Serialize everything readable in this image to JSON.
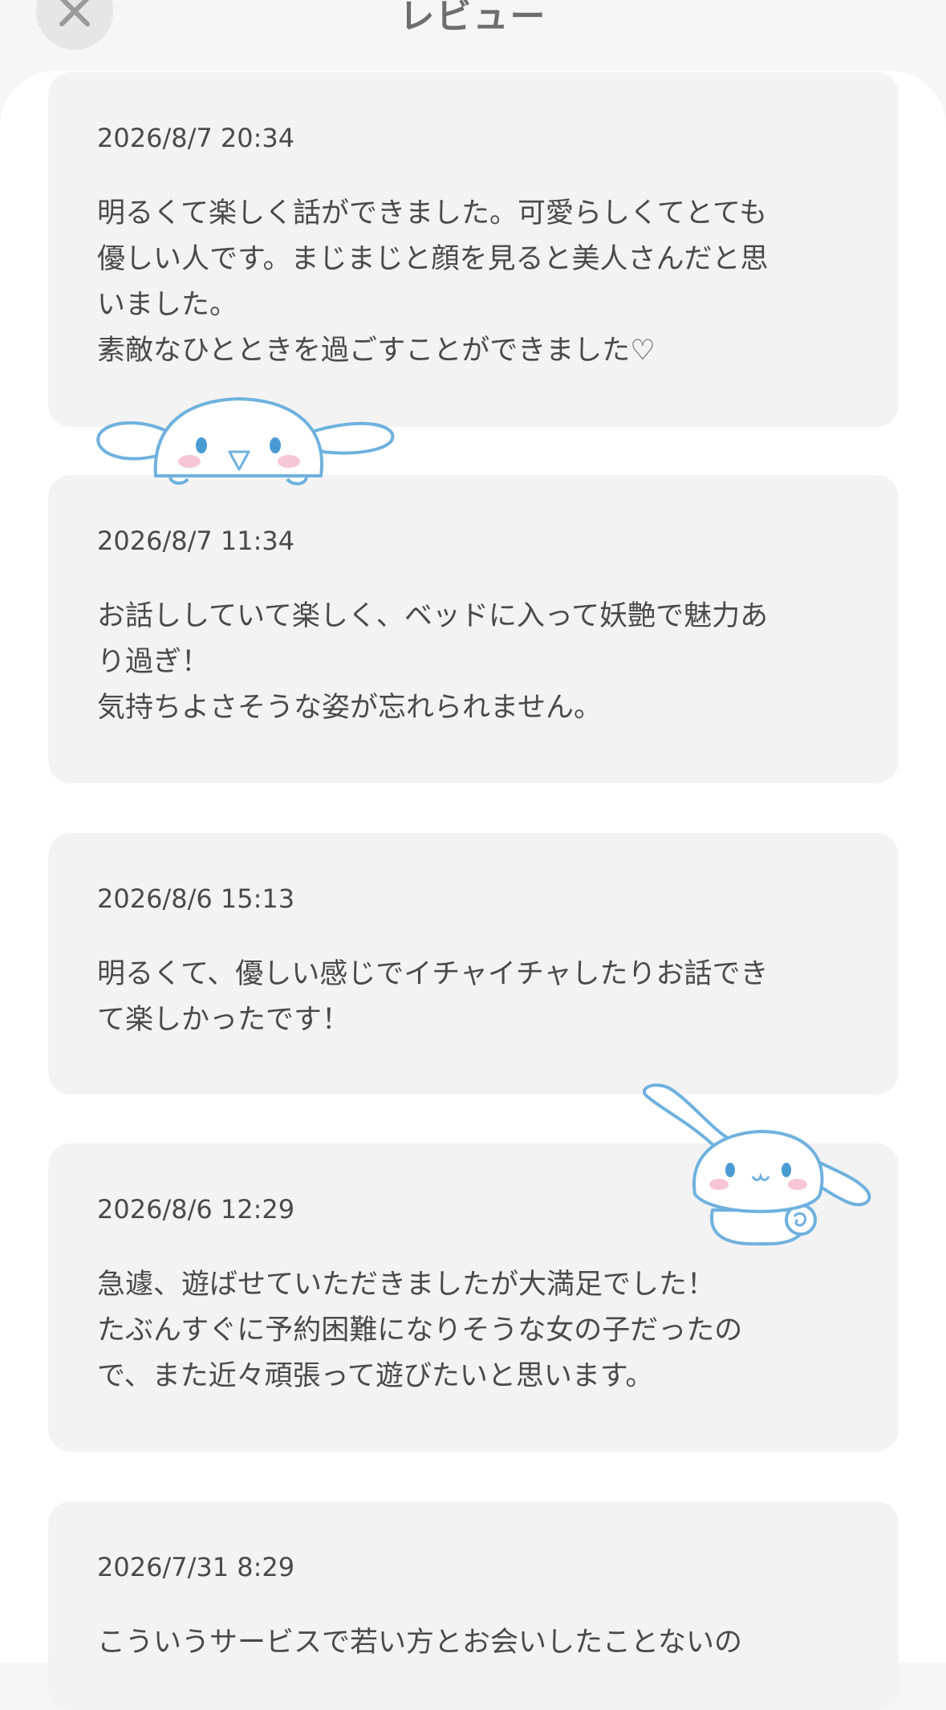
{
  "header": {
    "title": "レビュー"
  },
  "reviews": [
    {
      "date": "2026/8/7 20:34",
      "text": "明るくて楽しく話ができました。可愛らしくてとても\n優しい人です。まじまじと顔を見ると美人さんだと思\nいました。\n素敵なひとときを過ごすことができました♡"
    },
    {
      "date": "2026/8/7 11:34",
      "text": "お話ししていて楽しく、ベッドに入って妖艶で魅力あ\nり過ぎ！\n気持ちよさそうな姿が忘れられません。"
    },
    {
      "date": "2026/8/6 15:13",
      "text": "明るくて、優しい感じでイチャイチャしたりお話でき\nて楽しかったです！"
    },
    {
      "date": "2026/8/6 12:29",
      "text": "急遽、遊ばせていただきましたが大満足でした！\nたぶんすぐに予約困難になりそうな女の子だったの\nで、また近々頑張って遊びたいと思います。"
    },
    {
      "date": "2026/7/31 8:29",
      "text": "こういうサービスで若い方とお会いしたことないの"
    }
  ],
  "icons": {
    "close": "close-icon",
    "mascot_peek": "white-puppy-peeking-icon",
    "mascot_sitting": "white-puppy-sitting-icon"
  },
  "colors": {
    "background": "#f6f6f6",
    "sheet": "#ffffff",
    "card": "#f3f3f3",
    "text": "#4a4a4a",
    "mascot_outline": "#6fb1de",
    "mascot_cheek": "#f7c6d6"
  }
}
